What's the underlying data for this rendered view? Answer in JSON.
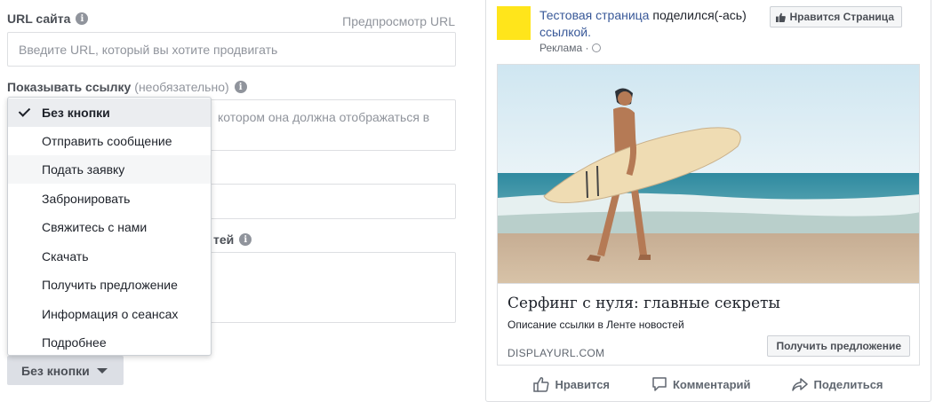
{
  "form": {
    "url_label": "URL сайта",
    "preview_url": "Предпросмотр URL",
    "url_placeholder": "Введите URL, который вы хотите продвигать",
    "display_link_label": "Показывать ссылку",
    "display_link_optional": "(необязательно)",
    "text_fragment_1": "котором она должна отображаться в",
    "desc_label_fragment": "тей",
    "cta_button_label": "Без кнопки"
  },
  "dropdown": {
    "selected_index": 0,
    "items": [
      "Без кнопки",
      "Отправить сообщение",
      "Подать заявку",
      "Забронировать",
      "Свяжитесь с нами",
      "Скачать",
      "Получить предложение",
      "Информация о сеансах",
      "Подробнее"
    ]
  },
  "ad": {
    "page_name": "Тестовая страница",
    "shared_text": " поделился(-ась) ",
    "shared_link": "ссылкой.",
    "sponsored": "Реклама ·",
    "like_page_button": "Нравится Страница",
    "headline": "Серфинг с нуля: главные секреты",
    "description": "Описание ссылки в Ленте новостей",
    "display_url": "DISPLAYURL.COM",
    "cta": "Получить предложение",
    "actions": {
      "like": "Нравится",
      "comment": "Комментарий",
      "share": "Поделиться"
    },
    "logo_color": "#ffe51b",
    "link_color": "#385898"
  }
}
